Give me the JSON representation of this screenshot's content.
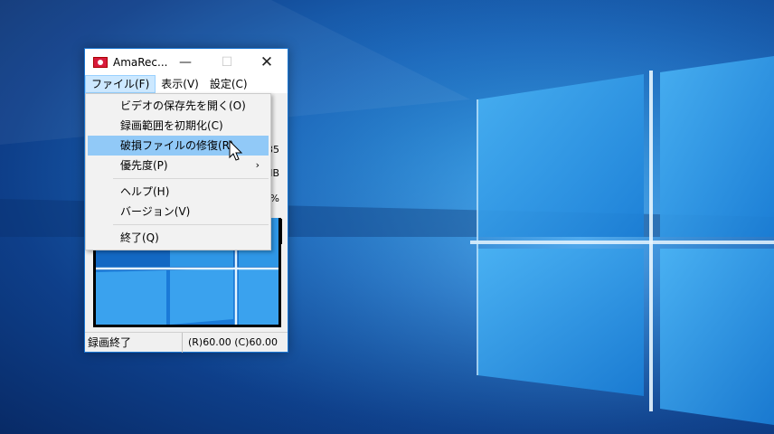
{
  "window": {
    "title": "AmaRec...",
    "minimize": "—",
    "maximize": "☐",
    "close": "✕"
  },
  "menubar": {
    "items": [
      "ファイル(F)",
      "表示(V)",
      "設定(C)"
    ]
  },
  "file_menu": {
    "items": [
      {
        "label": "ビデオの保存先を開く(O)"
      },
      {
        "label": "録画範囲を初期化(C)"
      },
      {
        "label": "破損ファイルの修復(R)",
        "highlighted": true
      },
      {
        "label": "優先度(P)",
        "submenu": true,
        "arrow": "›"
      },
      {
        "label": "ヘルプ(H)"
      },
      {
        "label": "バージョン(V)"
      },
      {
        "label": "終了(Q)"
      }
    ]
  },
  "edge_fragments": {
    "a": "35",
    "b": "MB",
    "c": "%"
  },
  "statusbar": {
    "left": "録画終了",
    "right": "(R)60.00 (C)60.00"
  },
  "colors": {
    "menu_highlight": "#91c9f7",
    "window_border": "#1a76d2",
    "desktop_blue": "#1f6fc2"
  }
}
